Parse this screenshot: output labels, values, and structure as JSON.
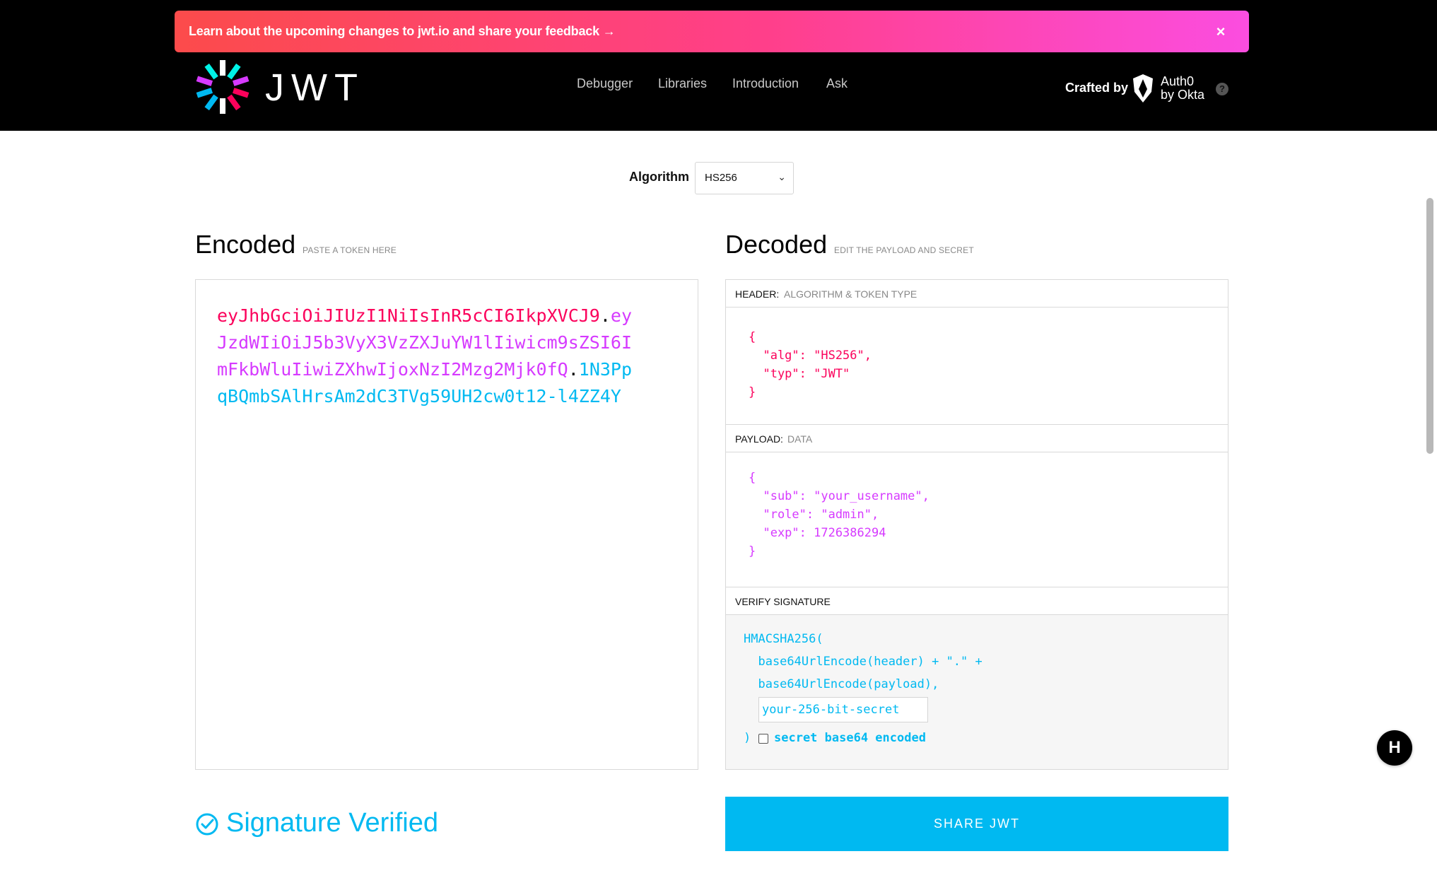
{
  "banner": {
    "text": "Learn about the upcoming changes to jwt.io and share your feedback →",
    "close_label": "×"
  },
  "logo": {
    "word": "JWT"
  },
  "nav": {
    "items": [
      {
        "label": "Debugger"
      },
      {
        "label": "Libraries"
      },
      {
        "label": "Introduction"
      },
      {
        "label": "Ask"
      }
    ]
  },
  "crafted": {
    "label": "Crafted by",
    "brand_line1": "Auth0",
    "brand_line2": "by Okta",
    "help": "?"
  },
  "algorithm": {
    "label": "Algorithm",
    "selected": "HS256"
  },
  "encoded": {
    "title": "Encoded",
    "subtitle": "PASTE A TOKEN HERE",
    "token_header": "eyJhbGciOiJIUzI1NiIsInR5cCI6IkpXVCJ9",
    "token_payload_l1": "ey",
    "token_payload_l2": "JzdWIiOiJ5b3VyX3VzZXJuYW1lIiwicm9sZSI6I",
    "token_payload_l3": "mFkbWluIiwiZXhwIjoxNzI2Mzg2Mjk0fQ",
    "token_sig_l3": "1N3Pp",
    "token_sig_l4": "qBQmbSAlHrsAm2dC3TVg59UH2cw0t12-l4ZZ4Y",
    "dot": "."
  },
  "decoded": {
    "title": "Decoded",
    "subtitle": "EDIT THE PAYLOAD AND SECRET",
    "header_label": "HEADER:",
    "header_desc": "ALGORITHM & TOKEN TYPE",
    "header_lines": [
      "{",
      "  \"alg\": \"HS256\",",
      "  \"typ\": \"JWT\"",
      "}"
    ],
    "payload_label": "PAYLOAD:",
    "payload_desc": "DATA",
    "payload_lines": [
      "{",
      "  \"sub\": \"your_username\",",
      "  \"role\": \"admin\",",
      "  \"exp\": 1726386294",
      "}"
    ],
    "verify_label": "VERIFY SIGNATURE",
    "verify_fn": "HMACSHA256(",
    "verify_l2": "  base64UrlEncode(header) + \".\" +",
    "verify_l3": "  base64UrlEncode(payload),",
    "secret_value": "your-256-bit-secret",
    "verify_close": ")",
    "base64_label": "secret base64 encoded"
  },
  "status": {
    "text": "Signature Verified"
  },
  "share": {
    "label": "SHARE JWT"
  },
  "widget": {
    "label": "H"
  },
  "colors": {
    "header_red": "#fb015b",
    "payload_purple": "#d63aff",
    "signature_blue": "#00b9f1"
  }
}
